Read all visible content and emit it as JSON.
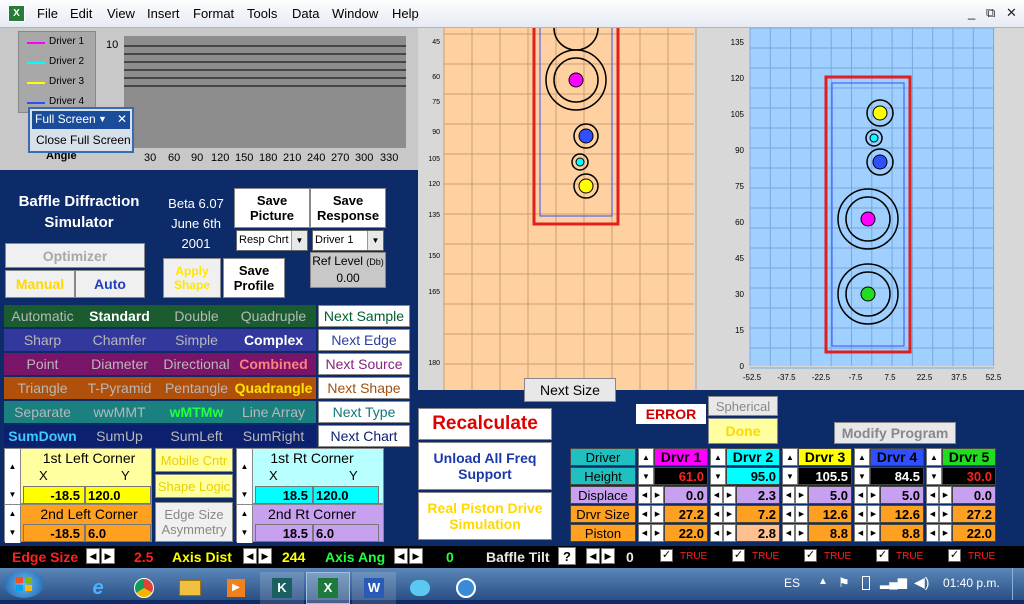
{
  "menu": [
    "File",
    "Edit",
    "View",
    "Insert",
    "Format",
    "Tools",
    "Data",
    "Window",
    "Help"
  ],
  "window_controls": {
    "minimize": "_",
    "restore": "⧉",
    "close": "✕"
  },
  "chart": {
    "legend": [
      "Driver 1",
      "Driver 2",
      "Driver 3",
      "Driver 4"
    ],
    "legend_colors": [
      "#ff00ff",
      "#00ffff",
      "#ffff00",
      "#3050ff"
    ],
    "ytick": "10",
    "xticks": [
      "30",
      "60",
      "90",
      "120",
      "150",
      "180",
      "210",
      "240",
      "270",
      "300",
      "330"
    ],
    "angle_label": "Angle"
  },
  "fullscreen": {
    "label": "Full Screen",
    "close": "Close Full Screen"
  },
  "app": {
    "title": "Baffle Diffraction Simulator",
    "version": "Beta 6.07",
    "date_line1": "June 6th",
    "date_line2": "2001"
  },
  "buttons": {
    "save_picture": "Save Picture",
    "save_response": "Save Response",
    "resp_chart": "Resp Chrt",
    "driver_select": "Driver 1",
    "ref_level": "Ref Level",
    "ref_unit": "(Db)",
    "ref_value": "0.00",
    "optimizer": "Optimizer",
    "manual": "Manual",
    "auto": "Auto",
    "apply_shape": "Apply Shape",
    "save_profile": "Save Profile",
    "next_size": "Next Size",
    "recalculate": "Recalculate",
    "unload_all": "Unload All Freq Support",
    "real_piston": "Real Piston Drive Simulation",
    "spherical": "Spherical",
    "done": "Done",
    "error": "ERROR",
    "modify_program": "Modify Program"
  },
  "option_rows": [
    {
      "items": [
        "Automatic",
        "Standard",
        "Double",
        "Quadruple"
      ],
      "next": "Next Sample",
      "bg": "#1a5c30",
      "next_color": "#006030"
    },
    {
      "items": [
        "Sharp",
        "Chamfer",
        "Simple",
        "Complex"
      ],
      "next": "Next Edge",
      "bg": "#32389c",
      "next_color": "#2a3fa0"
    },
    {
      "items": [
        "Point",
        "Diameter",
        "Directional",
        "Combined"
      ],
      "next": "Next Source",
      "bg": "#7a1468",
      "next_color": "#8a2080"
    },
    {
      "items": [
        "Triangle",
        "T-Pyramid",
        "Pentangle",
        "Quadrangle"
      ],
      "next": "Next Shape",
      "bg": "#b0500a",
      "next_color": "#a05010"
    },
    {
      "items": [
        "Separate",
        "wwMMT",
        "wMTMw",
        "Line Array"
      ],
      "next": "Next Type",
      "bg": "#1a8080",
      "next_color": "#107878"
    },
    {
      "items": [
        "SumDown",
        "SumUp",
        "SumLeft",
        "SumRight"
      ],
      "next": "Next Chart",
      "bg": "#0c2070",
      "next_color": "#0c2070"
    }
  ],
  "corners": {
    "first_left": "1st Left Corner",
    "first_right": "1st Rt Corner",
    "second_left": "2nd Left Corner",
    "second_right": "2nd Rt Corner",
    "x": "X",
    "y": "Y",
    "first_left_x": "-18.5",
    "first_left_y": "120.0",
    "first_right_x": "18.5",
    "first_right_y": "120.0",
    "second_left_x": "-18.5",
    "second_left_y": "6.0",
    "second_right_x": "18.5",
    "second_right_y": "6.0",
    "mobile_cntr": "Mobile Cntr",
    "shape_logic": "Shape Logic",
    "edge_size_asym": "Edge Size Asymmetry"
  },
  "left_plot": {
    "yticks": [
      "45",
      "60",
      "75",
      "90",
      "105",
      "120",
      "135",
      "150",
      "165",
      "180"
    ]
  },
  "right_plot": {
    "yticks": [
      "135",
      "120",
      "105",
      "90",
      "75",
      "60",
      "45",
      "30",
      "15",
      "0"
    ],
    "xticks": [
      "-52.5",
      "-37.5",
      "-22.5",
      "-7.5",
      "7.5",
      "22.5",
      "37.5",
      "52.5"
    ]
  },
  "drivers_table": {
    "row_labels": [
      "Driver",
      "Height",
      "Displace",
      "Drvr Size",
      "Piston"
    ],
    "columns": [
      {
        "name": "Drvr 1",
        "color": "#ff00ff",
        "height": "61.0",
        "displace": "0.0",
        "size": "27.2",
        "piston": "22.0"
      },
      {
        "name": "Drvr 2",
        "color": "#00ffff",
        "height": "95.0",
        "displace": "2.3",
        "size": "7.2",
        "piston": "2.8"
      },
      {
        "name": "Drvr 3",
        "color": "#ffff00",
        "height": "105.5",
        "displace": "5.0",
        "size": "12.6",
        "piston": "8.8"
      },
      {
        "name": "Drvr 4",
        "color": "#3050ff",
        "height": "84.5",
        "displace": "5.0",
        "size": "12.6",
        "piston": "8.8"
      },
      {
        "name": "Drvr 5",
        "color": "#20dd20",
        "height": "30.0",
        "displace": "0.0",
        "size": "27.2",
        "piston": "22.0"
      }
    ]
  },
  "bottom": {
    "edge_size": "Edge Size",
    "edge_value": "2.5",
    "axis_dist": "Axis Dist",
    "axis_value": "244",
    "axis_ang": "Axis Ang",
    "ang_value": "0",
    "baffle_tilt": "Baffle Tilt",
    "help": "?",
    "tilt_value": "0",
    "checks": [
      "TRUE",
      "TRUE",
      "TRUE",
      "TRUE",
      "TRUE"
    ]
  },
  "taskbar": {
    "lang": "ES",
    "time": "01:40 p.m."
  }
}
